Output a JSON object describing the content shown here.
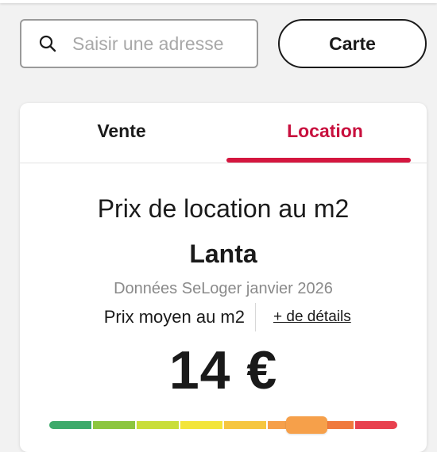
{
  "search": {
    "placeholder": "Saisir une adresse",
    "icon": "search-icon"
  },
  "map_button": {
    "label": "Carte"
  },
  "tabs": [
    {
      "label": "Vente",
      "active": false
    },
    {
      "label": "Location",
      "active": true
    }
  ],
  "price_card": {
    "title": "Prix de location au m2",
    "city": "Lanta",
    "source": "Données SeLoger janvier 2026",
    "avg_label": "Prix moyen au m2",
    "details_link": "+ de détails",
    "price": "14 €",
    "gauge_position": 0.74
  },
  "colors": {
    "accent": "#c8103e",
    "gauge": [
      "#3daa6b",
      "#8cc63f",
      "#c9de3a",
      "#f3e53a",
      "#f6c63f",
      "#f6a04a",
      "#f07a3e",
      "#e8414f"
    ]
  }
}
